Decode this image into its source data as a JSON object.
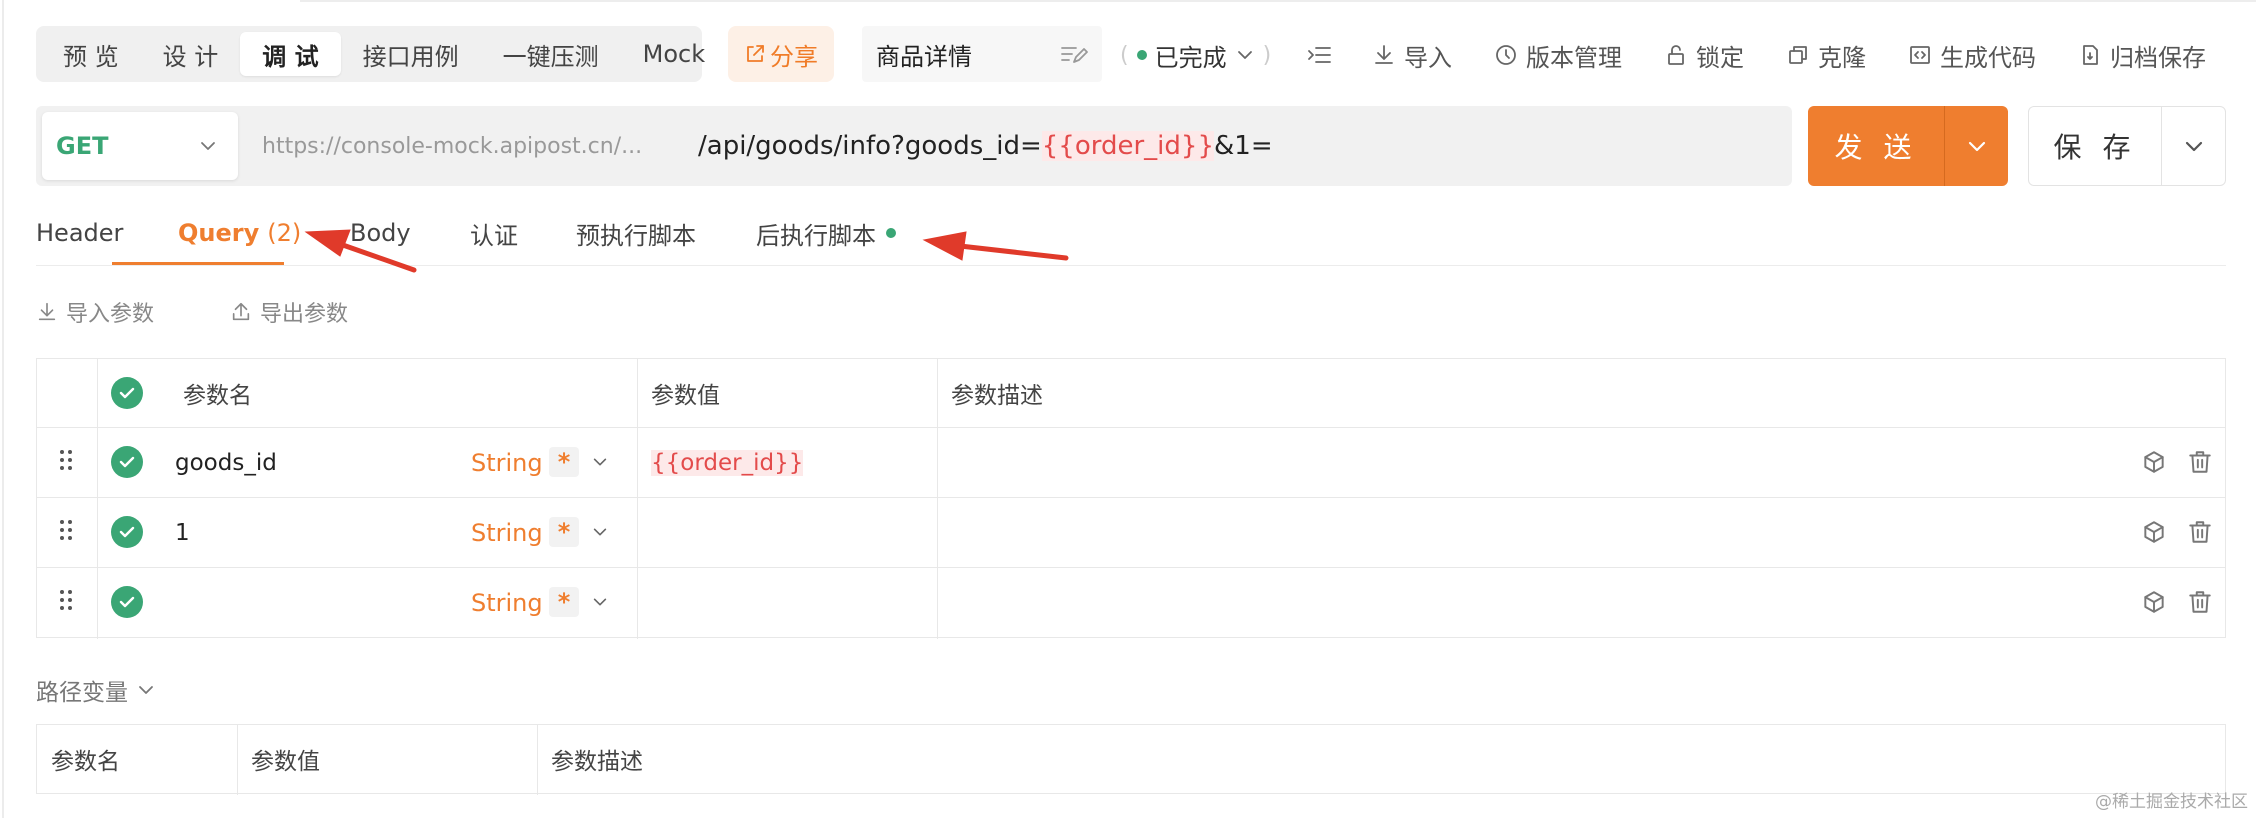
{
  "toolbar": {
    "modes": [
      "预 览",
      "设 计",
      "调 试",
      "接口用例",
      "一键压测",
      "Mock"
    ],
    "active_mode": "调 试",
    "share_label": "分享",
    "api_name": "商品详情",
    "status_label": "已完成",
    "import_label": "导入",
    "version_label": "版本管理",
    "lock_label": "锁定",
    "clone_label": "克隆",
    "gencode_label": "生成代码",
    "archive_label": "归档保存"
  },
  "request": {
    "method": "GET",
    "host": "https://console-mock.apipost.cn/...",
    "path_prefix": "/api/goods/info?goods_id=",
    "path_var": "{{order_id}}",
    "path_suffix": "&1=",
    "send_label": "发 送",
    "save_label": "保 存"
  },
  "tabs": {
    "header": "Header",
    "query": "Query",
    "query_count": "(2)",
    "body": "Body",
    "auth": "认证",
    "pre_script": "预执行脚本",
    "post_script": "后执行脚本"
  },
  "actions": {
    "import_params": "导入参数",
    "export_params": "导出参数"
  },
  "query_table": {
    "headers": {
      "name": "参数名",
      "value": "参数值",
      "desc": "参数描述"
    },
    "rows": [
      {
        "name": "goods_id",
        "type": "String",
        "required": "*",
        "value": "{{order_id}}",
        "desc": ""
      },
      {
        "name": "1",
        "type": "String",
        "required": "*",
        "value": "",
        "desc": ""
      },
      {
        "name": "",
        "type": "String",
        "required": "*",
        "value": "",
        "desc": ""
      }
    ]
  },
  "path_vars": {
    "title": "路径变量",
    "headers": {
      "name": "参数名",
      "value": "参数值",
      "desc": "参数描述"
    }
  },
  "watermark": "@稀土掘金技术社区",
  "colors": {
    "accent": "#ef7e2f",
    "success": "#3aa675",
    "variable": "#e34b4b",
    "annotation_arrow": "#e03a2a"
  }
}
